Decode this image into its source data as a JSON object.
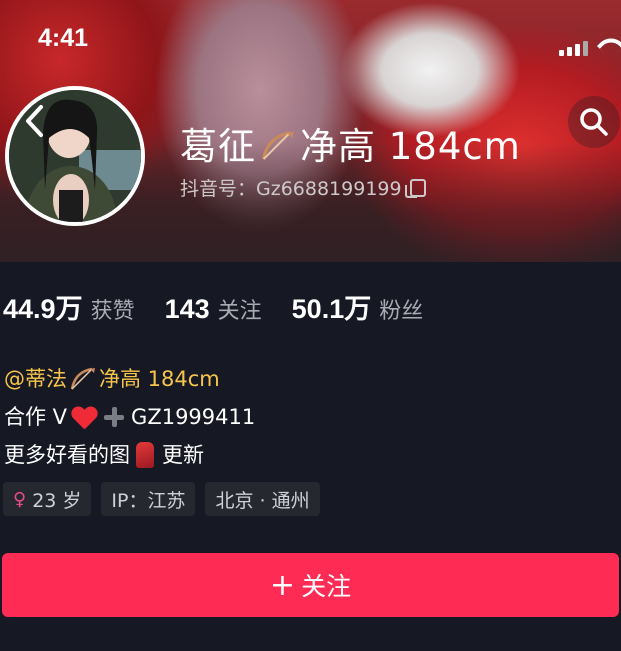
{
  "status_bar": {
    "time": "4:41"
  },
  "profile": {
    "display_name_prefix": "葛征",
    "display_name_suffix": "净高 184cm",
    "douyin_id": "抖音号：Gz6688199199"
  },
  "stats": [
    {
      "value": "44.9万",
      "label": "获赞"
    },
    {
      "value": "143",
      "label": "关注"
    },
    {
      "value": "50.1万",
      "label": "粉丝"
    }
  ],
  "bio": {
    "mention_prefix": "@蒂法",
    "mention_suffix": "净高 184cm",
    "line2_prefix": "合作 V",
    "line2_suffix": "GZ1999411",
    "line3_prefix": "更多好看的图",
    "line3_suffix": "更新"
  },
  "tags": {
    "age": "23 岁",
    "ip": "IP：江苏",
    "location": "北京 · 通州"
  },
  "follow_button": {
    "plus": "+",
    "label": "关注"
  },
  "colors": {
    "background": "#161823",
    "accent": "#fe2c55",
    "mention": "#f7c54b",
    "secondary_text": "#a9aab2",
    "tag_bg": "#262830"
  }
}
